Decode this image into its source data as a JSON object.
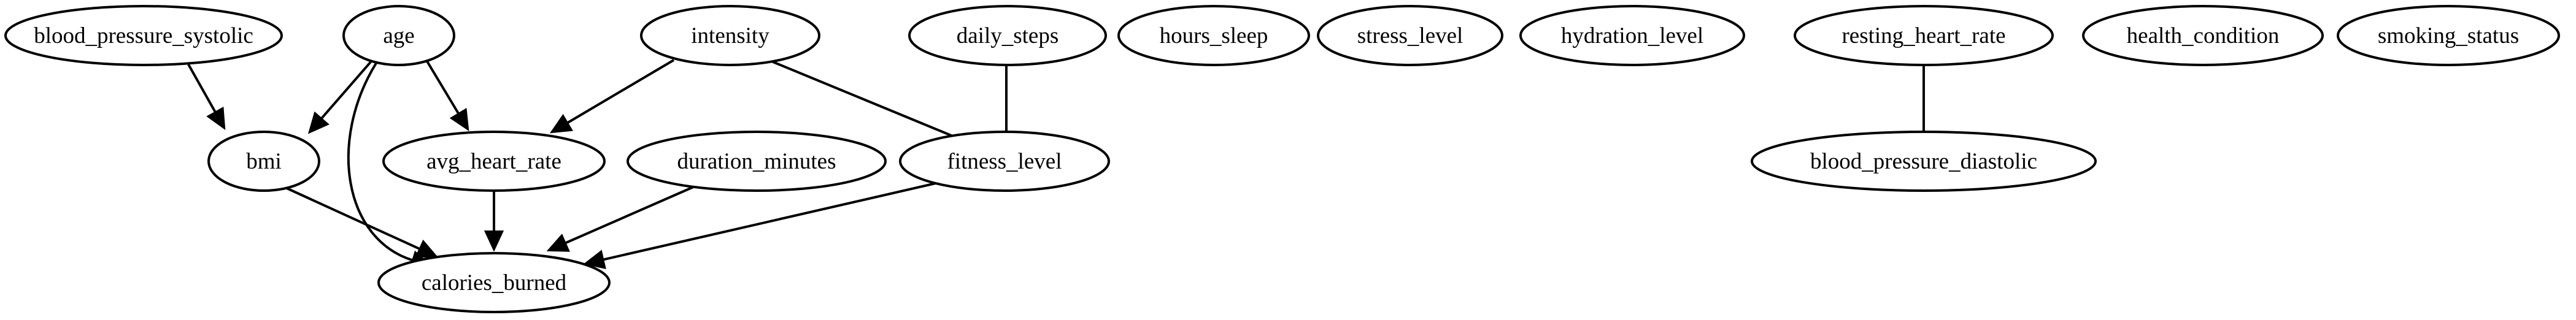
{
  "nodes": [
    {
      "id": "blood_pressure_systolic",
      "label": "blood_pressure_systolic"
    },
    {
      "id": "age",
      "label": "age"
    },
    {
      "id": "intensity",
      "label": "intensity"
    },
    {
      "id": "daily_steps",
      "label": "daily_steps"
    },
    {
      "id": "hours_sleep",
      "label": "hours_sleep"
    },
    {
      "id": "stress_level",
      "label": "stress_level"
    },
    {
      "id": "hydration_level",
      "label": "hydration_level"
    },
    {
      "id": "resting_heart_rate",
      "label": "resting_heart_rate"
    },
    {
      "id": "health_condition",
      "label": "health_condition"
    },
    {
      "id": "smoking_status",
      "label": "smoking_status"
    },
    {
      "id": "bmi",
      "label": "bmi"
    },
    {
      "id": "avg_heart_rate",
      "label": "avg_heart_rate"
    },
    {
      "id": "duration_minutes",
      "label": "duration_minutes"
    },
    {
      "id": "fitness_level",
      "label": "fitness_level"
    },
    {
      "id": "blood_pressure_diastolic",
      "label": "blood_pressure_diastolic"
    },
    {
      "id": "calories_burned",
      "label": "calories_burned"
    }
  ],
  "edges": [
    {
      "from": "blood_pressure_systolic",
      "to": "bmi",
      "directed": true
    },
    {
      "from": "age",
      "to": "bmi",
      "directed": true
    },
    {
      "from": "age",
      "to": "avg_heart_rate",
      "directed": true
    },
    {
      "from": "age",
      "to": "calories_burned",
      "directed": true
    },
    {
      "from": "intensity",
      "to": "avg_heart_rate",
      "directed": true
    },
    {
      "from": "intensity",
      "to": "fitness_level",
      "directed": false
    },
    {
      "from": "daily_steps",
      "to": "fitness_level",
      "directed": false
    },
    {
      "from": "resting_heart_rate",
      "to": "blood_pressure_diastolic",
      "directed": false
    },
    {
      "from": "bmi",
      "to": "calories_burned",
      "directed": true
    },
    {
      "from": "avg_heart_rate",
      "to": "calories_burned",
      "directed": true
    },
    {
      "from": "duration_minutes",
      "to": "calories_burned",
      "directed": true
    },
    {
      "from": "fitness_level",
      "to": "calories_burned",
      "directed": true
    }
  ]
}
